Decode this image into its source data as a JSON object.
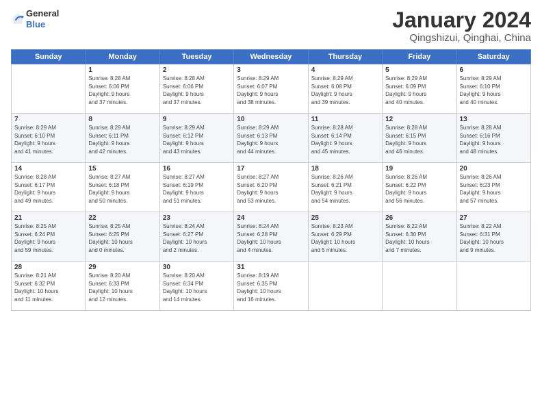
{
  "header": {
    "logo_line1": "General",
    "logo_line2": "Blue",
    "title": "January 2024",
    "subtitle": "Qingshizui, Qinghai, China"
  },
  "days_of_week": [
    "Sunday",
    "Monday",
    "Tuesday",
    "Wednesday",
    "Thursday",
    "Friday",
    "Saturday"
  ],
  "weeks": [
    [
      {
        "num": "",
        "info": ""
      },
      {
        "num": "1",
        "info": "Sunrise: 8:28 AM\nSunset: 6:06 PM\nDaylight: 9 hours\nand 37 minutes."
      },
      {
        "num": "2",
        "info": "Sunrise: 8:28 AM\nSunset: 6:06 PM\nDaylight: 9 hours\nand 37 minutes."
      },
      {
        "num": "3",
        "info": "Sunrise: 8:29 AM\nSunset: 6:07 PM\nDaylight: 9 hours\nand 38 minutes."
      },
      {
        "num": "4",
        "info": "Sunrise: 8:29 AM\nSunset: 6:08 PM\nDaylight: 9 hours\nand 39 minutes."
      },
      {
        "num": "5",
        "info": "Sunrise: 8:29 AM\nSunset: 6:09 PM\nDaylight: 9 hours\nand 40 minutes."
      },
      {
        "num": "6",
        "info": "Sunrise: 8:29 AM\nSunset: 6:10 PM\nDaylight: 9 hours\nand 40 minutes."
      }
    ],
    [
      {
        "num": "7",
        "info": "Sunrise: 8:29 AM\nSunset: 6:10 PM\nDaylight: 9 hours\nand 41 minutes."
      },
      {
        "num": "8",
        "info": "Sunrise: 8:29 AM\nSunset: 6:11 PM\nDaylight: 9 hours\nand 42 minutes."
      },
      {
        "num": "9",
        "info": "Sunrise: 8:29 AM\nSunset: 6:12 PM\nDaylight: 9 hours\nand 43 minutes."
      },
      {
        "num": "10",
        "info": "Sunrise: 8:29 AM\nSunset: 6:13 PM\nDaylight: 9 hours\nand 44 minutes."
      },
      {
        "num": "11",
        "info": "Sunrise: 8:28 AM\nSunset: 6:14 PM\nDaylight: 9 hours\nand 45 minutes."
      },
      {
        "num": "12",
        "info": "Sunrise: 8:28 AM\nSunset: 6:15 PM\nDaylight: 9 hours\nand 46 minutes."
      },
      {
        "num": "13",
        "info": "Sunrise: 8:28 AM\nSunset: 6:16 PM\nDaylight: 9 hours\nand 48 minutes."
      }
    ],
    [
      {
        "num": "14",
        "info": "Sunrise: 8:28 AM\nSunset: 6:17 PM\nDaylight: 9 hours\nand 49 minutes."
      },
      {
        "num": "15",
        "info": "Sunrise: 8:27 AM\nSunset: 6:18 PM\nDaylight: 9 hours\nand 50 minutes."
      },
      {
        "num": "16",
        "info": "Sunrise: 8:27 AM\nSunset: 6:19 PM\nDaylight: 9 hours\nand 51 minutes."
      },
      {
        "num": "17",
        "info": "Sunrise: 8:27 AM\nSunset: 6:20 PM\nDaylight: 9 hours\nand 53 minutes."
      },
      {
        "num": "18",
        "info": "Sunrise: 8:26 AM\nSunset: 6:21 PM\nDaylight: 9 hours\nand 54 minutes."
      },
      {
        "num": "19",
        "info": "Sunrise: 8:26 AM\nSunset: 6:22 PM\nDaylight: 9 hours\nand 56 minutes."
      },
      {
        "num": "20",
        "info": "Sunrise: 8:26 AM\nSunset: 6:23 PM\nDaylight: 9 hours\nand 57 minutes."
      }
    ],
    [
      {
        "num": "21",
        "info": "Sunrise: 8:25 AM\nSunset: 6:24 PM\nDaylight: 9 hours\nand 59 minutes."
      },
      {
        "num": "22",
        "info": "Sunrise: 8:25 AM\nSunset: 6:25 PM\nDaylight: 10 hours\nand 0 minutes."
      },
      {
        "num": "23",
        "info": "Sunrise: 8:24 AM\nSunset: 6:27 PM\nDaylight: 10 hours\nand 2 minutes."
      },
      {
        "num": "24",
        "info": "Sunrise: 8:24 AM\nSunset: 6:28 PM\nDaylight: 10 hours\nand 4 minutes."
      },
      {
        "num": "25",
        "info": "Sunrise: 8:23 AM\nSunset: 6:29 PM\nDaylight: 10 hours\nand 5 minutes."
      },
      {
        "num": "26",
        "info": "Sunrise: 8:22 AM\nSunset: 6:30 PM\nDaylight: 10 hours\nand 7 minutes."
      },
      {
        "num": "27",
        "info": "Sunrise: 8:22 AM\nSunset: 6:31 PM\nDaylight: 10 hours\nand 9 minutes."
      }
    ],
    [
      {
        "num": "28",
        "info": "Sunrise: 8:21 AM\nSunset: 6:32 PM\nDaylight: 10 hours\nand 11 minutes."
      },
      {
        "num": "29",
        "info": "Sunrise: 8:20 AM\nSunset: 6:33 PM\nDaylight: 10 hours\nand 12 minutes."
      },
      {
        "num": "30",
        "info": "Sunrise: 8:20 AM\nSunset: 6:34 PM\nDaylight: 10 hours\nand 14 minutes."
      },
      {
        "num": "31",
        "info": "Sunrise: 8:19 AM\nSunset: 6:35 PM\nDaylight: 10 hours\nand 16 minutes."
      },
      {
        "num": "",
        "info": ""
      },
      {
        "num": "",
        "info": ""
      },
      {
        "num": "",
        "info": ""
      }
    ]
  ]
}
